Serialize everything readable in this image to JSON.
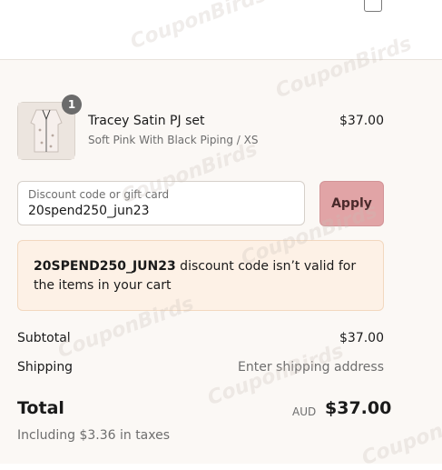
{
  "header": {
    "bag_icon": "shopping-bag-icon"
  },
  "product": {
    "quantity": "1",
    "name": "Tracey Satin PJ set",
    "variant": "Soft Pink With Black Piping / XS",
    "price": "$37.00"
  },
  "discount": {
    "placeholder": "Discount code or gift card",
    "value": "20spend250_jun23",
    "apply_label": "Apply"
  },
  "error": {
    "code": "20SPEND250_JUN23",
    "message": " discount code isn’t valid for the items in your cart"
  },
  "totals": {
    "subtotal_label": "Subtotal",
    "subtotal_value": "$37.00",
    "shipping_label": "Shipping",
    "shipping_value": "Enter shipping address",
    "total_label": "Total",
    "currency": "AUD",
    "total_value": "$37.00",
    "taxes_note": "Including $3.36 in taxes"
  },
  "watermark": "CouponBirds",
  "colors": {
    "apply_button": "#e1a4a6",
    "error_background": "#fdf1e6",
    "summary_background": "#fbf8f5"
  }
}
